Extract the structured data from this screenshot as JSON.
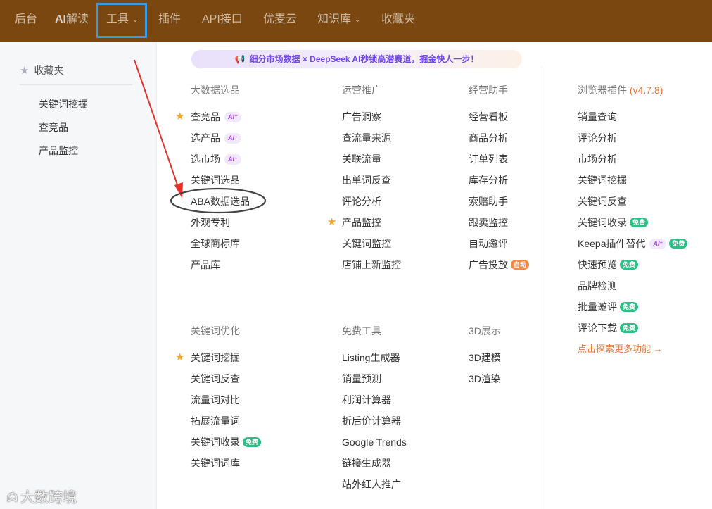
{
  "topnav": {
    "items": [
      {
        "label": "后台"
      },
      {
        "label_ai": "AI",
        "label": "解读"
      },
      {
        "label": "工具"
      },
      {
        "label": "插件"
      },
      {
        "label": "API接口"
      },
      {
        "label": "优麦云"
      },
      {
        "label": "知识库"
      },
      {
        "label": "收藏夹"
      }
    ],
    "active": "工具",
    "chevron": "⌄"
  },
  "sidebar": {
    "title": "收藏夹",
    "items": [
      "关键词挖掘",
      "查竞品",
      "产品监控"
    ]
  },
  "banner": {
    "icon": "megaphone-icon",
    "text": "细分市场数据 × DeepSeek AI秒锁高潜赛道，掘金快人一步！"
  },
  "badges": {
    "ai": "AI⁺",
    "free": "免费",
    "auto": "自动"
  },
  "columns": {
    "big_data": {
      "title": "大数据选品",
      "items": [
        "查竞品",
        "选产品",
        "选市场",
        "关键词选品",
        "ABA数据选品",
        "外观专利",
        "全球商标库",
        "产品库"
      ]
    },
    "operations": {
      "title": "运营推广",
      "items": [
        "广告洞察",
        "查流量来源",
        "关联流量",
        "出单词反查",
        "评论分析",
        "产品监控",
        "关键词监控",
        "店铺上新监控"
      ]
    },
    "assistant": {
      "title": "经营助手",
      "items": [
        "经营看板",
        "商品分析",
        "订单列表",
        "库存分析",
        "索赔助手",
        "跟卖监控",
        "自动邀评",
        "广告投放"
      ]
    },
    "keyword_opt": {
      "title": "关键词优化",
      "items": [
        "关键词挖掘",
        "关键词反查",
        "流量词对比",
        "拓展流量词",
        "关键词收录",
        "关键词词库"
      ]
    },
    "free_tools": {
      "title": "免费工具",
      "items": [
        "Listing生成器",
        "销量预测",
        "利润计算器",
        "折后价计算器",
        "Google Trends",
        "链接生成器",
        "站外红人推广"
      ]
    },
    "display_3d": {
      "title": "3D展示",
      "items": [
        "3D建模",
        "3D渲染"
      ]
    },
    "browser_plugin": {
      "title": "浏览器插件",
      "version": "(v4.7.8)",
      "items": [
        "销量查询",
        "评论分析",
        "市场分析",
        "关键词挖掘",
        "关键词反查",
        "关键词收录",
        "Keepa插件替代",
        "快速预览",
        "品牌检测",
        "批量邀评",
        "评论下载"
      ],
      "more": "点击探索更多功能 →"
    }
  },
  "annotation": {
    "highlight": "ABA数据选品",
    "color": "#e8302a",
    "ellipse_color": "#444444"
  },
  "watermark": {
    "logo": "logo-icon",
    "text": "大数跨境"
  }
}
